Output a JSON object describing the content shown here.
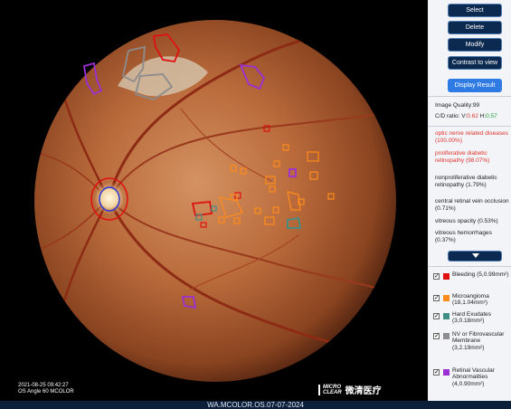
{
  "image": {
    "timestamp": "2021-08-25 09:42:27",
    "meta": "OS  Angle 60  MCOLOR",
    "brand_logo_top": "MICRO",
    "brand_logo_bottom": "CLEAR",
    "brand_cn": "微清医疗"
  },
  "footer": {
    "filename": "WA.MCOLOR.OS.07-07-2024"
  },
  "toolbar": {
    "select": "Select",
    "delete": "Delete",
    "modify": "Modify",
    "contrast": "Contrast to view",
    "display_result": "Display Result"
  },
  "results": {
    "image_quality": "Image Quality:99",
    "cd_label": "C/D ratio: ",
    "cd_v_prefix": "V:",
    "cd_v": "0.62",
    "cd_h_prefix": " H:",
    "cd_h": "0.57",
    "findings": [
      {
        "text": "optic nerve related diseases (100.00%)",
        "color": "#e0332b"
      },
      {
        "text": "proliferative diabetic retinopathy (98.07%)",
        "color": "#e0332b"
      },
      {
        "text": "nonproliferative diabetic retinopathy (1.79%)",
        "color": "#222222"
      },
      {
        "text": "central retinal vein occlusion (0.71%)",
        "color": "#222222"
      },
      {
        "text": "vitreous opacity (0.53%)",
        "color": "#222222"
      },
      {
        "text": "vitreous hemorrhages (0.37%)",
        "color": "#222222"
      }
    ]
  },
  "legend": [
    {
      "label": "Bleeding (5,0.99mm²)",
      "color": "#e01010",
      "checked": true
    },
    {
      "label": "Microangioma (18,1.04mm²)",
      "color": "#ff8c1a",
      "checked": true
    },
    {
      "label": "Hard Exudates (3,0.18mm²)",
      "color": "#3f8f87",
      "checked": true
    },
    {
      "label": "NV or Fibrovascular Membrane (3,2.19mm²)",
      "color": "#8c8c8c",
      "checked": true
    },
    {
      "label": "Retinal Vascular Abnormalities (4,0.90mm²)",
      "color": "#9b2fd6",
      "checked": true
    }
  ],
  "colors": {
    "optic_disc_ring": "#e01010",
    "optic_cup_ring": "#2a35d8",
    "accent_blue": "#2e7be3"
  }
}
